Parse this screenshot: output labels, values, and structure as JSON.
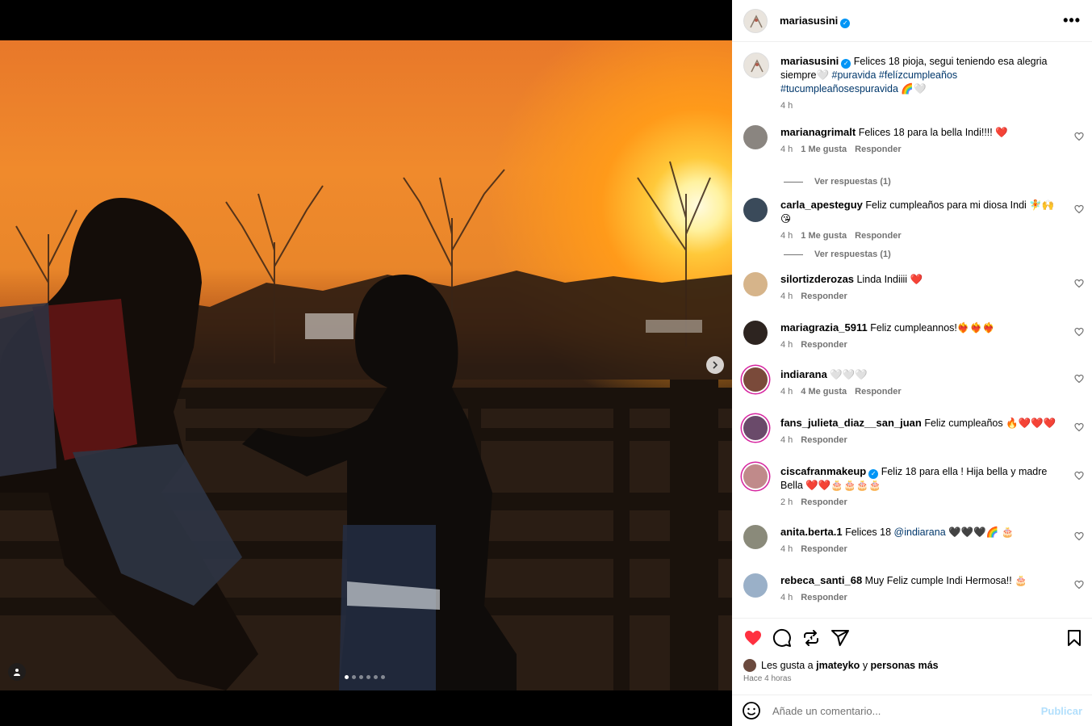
{
  "post": {
    "username": "mariasusini",
    "verified_icon": "verified-badge-icon",
    "caption_text": "Felices 18 pioja, segui teniendo esa alegria siempre🤍",
    "caption_hashtags": "#puravida #felízcumpleaños #tucumpleañosespuravida",
    "caption_tail": "🌈🤍",
    "caption_time": "4 h",
    "image_alt": "Dos personas a contraluz en una tranquera al atardecer",
    "carousel_count": 6,
    "carousel_active": 1
  },
  "comments": [
    {
      "user": "marianagrimalt",
      "text": "Felices 18 para la bella Indi!!!! ❤️",
      "time": "4 h",
      "likes": "1 Me gusta",
      "reply": "Responder",
      "replies": "Ver respuestas (1)"
    },
    {
      "user": "carla_apesteguy",
      "text": "Feliz cumpleaños para mi diosa Indi 🧚🙌😘",
      "time": "4 h",
      "likes": "1 Me gusta",
      "reply": "Responder",
      "replies": "Ver respuestas (1)"
    },
    {
      "user": "silortizderozas",
      "text": "Linda Indiiii ❤️",
      "time": "4 h",
      "reply": "Responder"
    },
    {
      "user": "mariagrazia_5911",
      "text": "Feliz cumpleannos!❤️‍🔥❤️‍🔥❤️‍🔥",
      "time": "4 h",
      "reply": "Responder"
    },
    {
      "user": "indiarana",
      "text": "🤍🤍🤍",
      "time": "4 h",
      "likes": "4 Me gusta",
      "reply": "Responder"
    },
    {
      "user": "fans_julieta_diaz__san_juan",
      "text": "Feliz cumpleaños 🔥❤️❤️❤️",
      "time": "4 h",
      "reply": "Responder"
    },
    {
      "user": "ciscafranmakeup",
      "text": "Feliz 18 para ella ! Hija bella y madre Bella ❤️❤️🎂🎂🎂🎂",
      "time": "2 h",
      "reply": "Responder"
    },
    {
      "user": "anita.berta.1",
      "text_before": "Felices 18",
      "mention": "@indiarana",
      "text_after": "🖤🖤🖤🌈 🎂",
      "time": "4 h",
      "reply": "Responder"
    },
    {
      "user": "rebeca_santi_68",
      "text": "Muy Feliz cumple Indi Hermosa!! 🎂",
      "time": "4 h",
      "reply": "Responder"
    }
  ],
  "actions": {
    "liked_prefix": "Les gusta a",
    "liked_user": "jmateyko",
    "liked_joiner": "y",
    "liked_others": "personas más",
    "time_ago": "Hace 4 horas"
  },
  "add_comment": {
    "placeholder": "Añade un comentario...",
    "publish": "Publicar"
  },
  "colors": {
    "like_red": "#ff3040",
    "link_blue": "#00376b",
    "verified": "#0095f6",
    "publish_disabled": "#b2dffc",
    "meta_gray": "#737373"
  }
}
